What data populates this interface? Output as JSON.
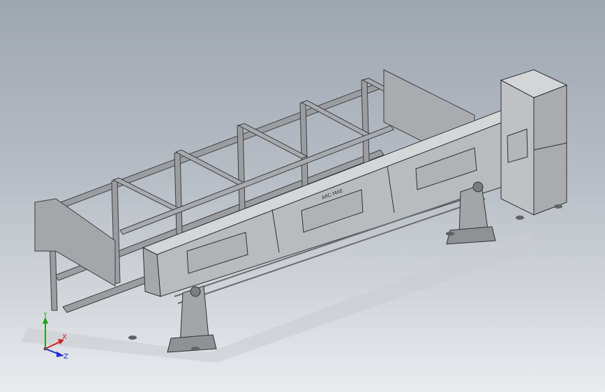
{
  "panel": {
    "brand_text": "ARC-MAE"
  },
  "triad": {
    "x_label": "X",
    "y_label": "Y",
    "z_label": "Z"
  },
  "colors": {
    "background_top": "#9ea6b0",
    "background_bottom": "#e9ebee",
    "frame": "#9b9da0",
    "frame_dark": "#6f7276",
    "panel_front": "#b9bbbe",
    "panel_top": "#d4d6d8",
    "axis_x": "#d21f1f",
    "axis_y": "#1da31d",
    "axis_z": "#1c2fd0"
  }
}
